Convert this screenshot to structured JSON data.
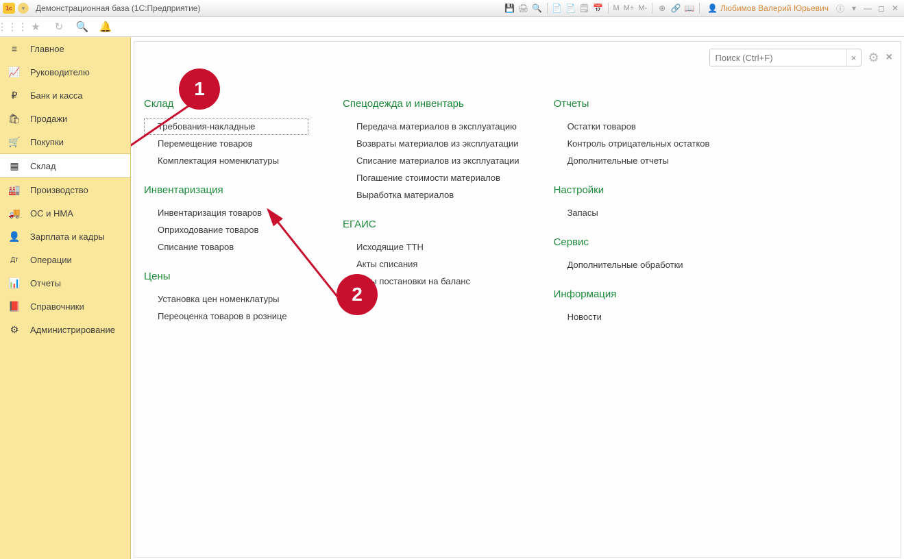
{
  "title": "Демонстрационная база  (1С:Предприятие)",
  "user": "Любимов Валерий Юрьевич",
  "search": {
    "placeholder": "Поиск (Ctrl+F)"
  },
  "toolbar_txt": {
    "m": "M",
    "mplus": "M+",
    "mminus": "M-"
  },
  "nav": [
    {
      "icon": "≡",
      "label": "Главное"
    },
    {
      "icon": "📈",
      "label": "Руководителю"
    },
    {
      "icon": "₽",
      "label": "Банк и касса"
    },
    {
      "icon": "🛍",
      "label": "Продажи"
    },
    {
      "icon": "🛒",
      "label": "Покупки"
    },
    {
      "icon": "▦",
      "label": "Склад"
    },
    {
      "icon": "🏭",
      "label": "Производство"
    },
    {
      "icon": "🚚",
      "label": "ОС и НМА"
    },
    {
      "icon": "👤",
      "label": "Зарплата и кадры"
    },
    {
      "icon": "Дт",
      "label": "Операции"
    },
    {
      "icon": "📊",
      "label": "Отчеты"
    },
    {
      "icon": "📕",
      "label": "Справочники"
    },
    {
      "icon": "⚙",
      "label": "Администрирование"
    }
  ],
  "col1": {
    "g1": {
      "title": "Склад",
      "links": [
        "Требования-накладные",
        "Перемещение товаров",
        "Комплектация номенклатуры"
      ]
    },
    "g2": {
      "title": "Инвентаризация",
      "links": [
        "Инвентаризация товаров",
        "Оприходование товаров",
        "Списание товаров"
      ]
    },
    "g3": {
      "title": "Цены",
      "links": [
        "Установка цен номенклатуры",
        "Переоценка товаров в рознице"
      ]
    }
  },
  "col2": {
    "g1": {
      "title": "Спецодежда и инвентарь",
      "links": [
        "Передача материалов в эксплуатацию",
        "Возвраты материалов из эксплуатации",
        "Списание материалов из эксплуатации",
        "Погашение стоимости материалов",
        "Выработка материалов"
      ]
    },
    "g2": {
      "title": "ЕГАИС",
      "links": [
        "Исходящие ТТН",
        "Акты списания",
        "Акты постановки на баланс"
      ]
    }
  },
  "col3": {
    "g1": {
      "title": "Отчеты",
      "links": [
        "Остатки товаров",
        "Контроль отрицательных остатков",
        "Дополнительные отчеты"
      ]
    },
    "g2": {
      "title": "Настройки",
      "links": [
        "Запасы"
      ]
    },
    "g3": {
      "title": "Сервис",
      "links": [
        "Дополнительные обработки"
      ]
    },
    "g4": {
      "title": "Информация",
      "links": [
        "Новости"
      ]
    }
  },
  "callouts": {
    "c1": "1",
    "c2": "2"
  }
}
